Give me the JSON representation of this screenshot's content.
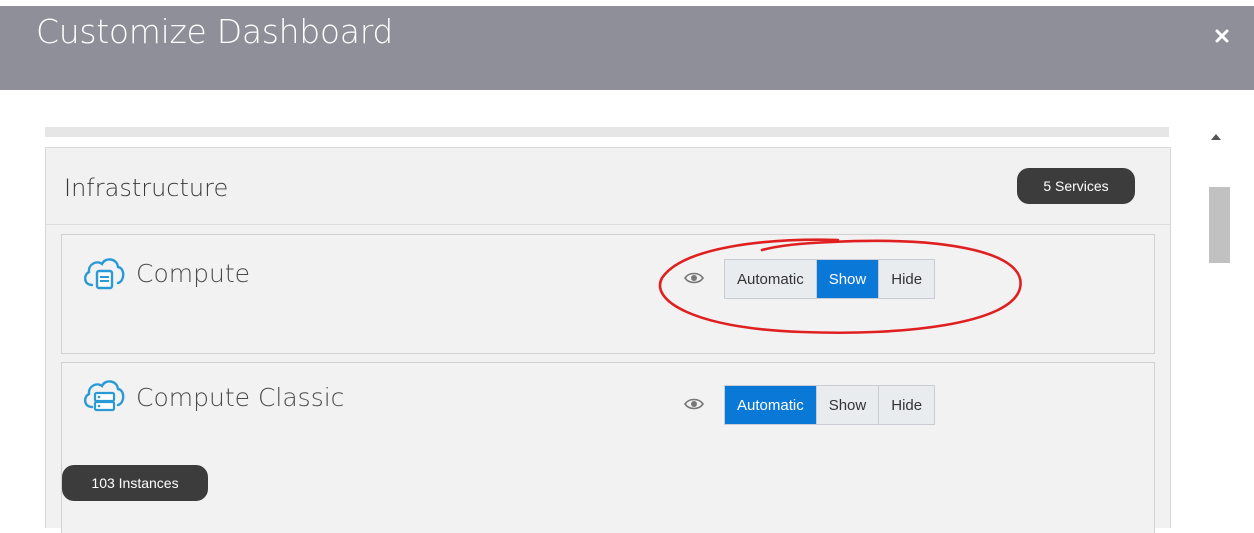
{
  "dialog": {
    "title": "Customize Dashboard",
    "close_icon": "close-icon"
  },
  "group": {
    "title": "Infrastructure",
    "badge": "5 Services"
  },
  "services": [
    {
      "name": "Compute",
      "icon": "cloud-compute-icon",
      "visibility_options": [
        "Automatic",
        "Show",
        "Hide"
      ],
      "selected": "Show"
    },
    {
      "name": "Compute Classic",
      "icon": "cloud-compute-classic-icon",
      "visibility_options": [
        "Automatic",
        "Show",
        "Hide"
      ],
      "selected": "Automatic",
      "badge": "103 Instances"
    }
  ],
  "colors": {
    "header": "#8e8f99",
    "active_segment": "#0a78d7",
    "badge": "#3c3c3c",
    "annotation": "#e02020"
  }
}
